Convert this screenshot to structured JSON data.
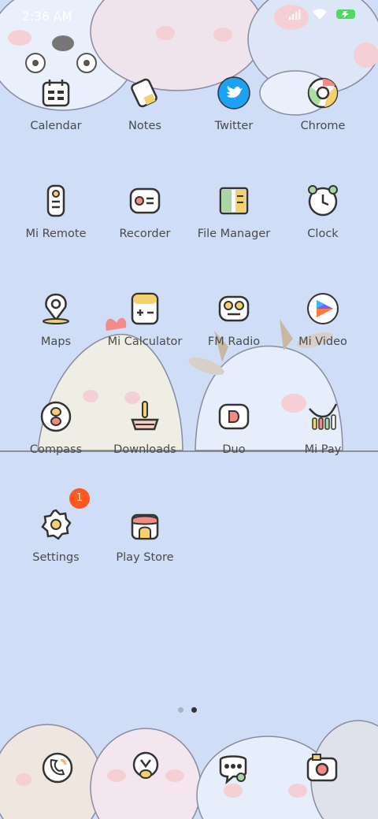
{
  "status_bar": {
    "time": "2:36 AM",
    "signal_icon": "signal-bars-icon",
    "wifi_icon": "wifi-icon",
    "battery_icon": "battery-charging-icon"
  },
  "colors": {
    "background": "#cfddf7",
    "label": "#4a4a4a",
    "badge": "#ff5722",
    "twitter": "#1da1f2"
  },
  "apps": [
    {
      "label": "Calendar",
      "icon": "calendar-icon"
    },
    {
      "label": "Notes",
      "icon": "notes-icon"
    },
    {
      "label": "Twitter",
      "icon": "twitter-bird-icon"
    },
    {
      "label": "Chrome",
      "icon": "chrome-icon"
    },
    {
      "label": "Mi Remote",
      "icon": "remote-icon"
    },
    {
      "label": "Recorder",
      "icon": "recorder-icon"
    },
    {
      "label": "File Manager",
      "icon": "file-manager-icon"
    },
    {
      "label": "Clock",
      "icon": "clock-icon"
    },
    {
      "label": "Maps",
      "icon": "map-pin-icon"
    },
    {
      "label": "Mi Calculator",
      "icon": "calculator-icon"
    },
    {
      "label": "FM Radio",
      "icon": "radio-icon"
    },
    {
      "label": "Mi Video",
      "icon": "video-play-icon"
    },
    {
      "label": "Compass",
      "icon": "compass-icon"
    },
    {
      "label": "Downloads",
      "icon": "download-icon"
    },
    {
      "label": "Duo",
      "icon": "duo-video-icon"
    },
    {
      "label": "Mi Pay",
      "icon": "mi-pay-icon"
    },
    {
      "label": "Settings",
      "icon": "gear-icon",
      "badge": "1"
    },
    {
      "label": "Play Store",
      "icon": "play-store-icon"
    }
  ],
  "page_indicator": {
    "pages": 2,
    "current": 2
  },
  "dock": [
    {
      "icon": "phone-icon"
    },
    {
      "icon": "browser-icon"
    },
    {
      "icon": "messages-icon"
    },
    {
      "icon": "camera-icon"
    }
  ]
}
